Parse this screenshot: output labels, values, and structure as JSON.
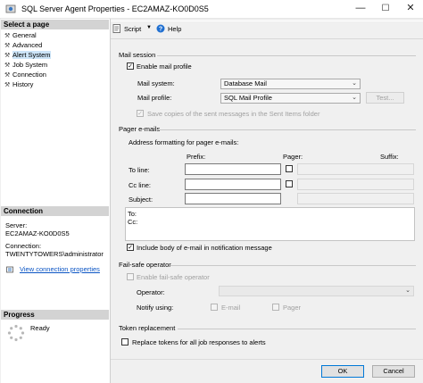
{
  "window": {
    "title": "SQL Server Agent Properties - EC2AMAZ-KO0D0S5",
    "minimize": "—",
    "maximize": "☐",
    "close": "✕"
  },
  "left": {
    "select_page_header": "Select a page",
    "pages": [
      {
        "label": "General"
      },
      {
        "label": "Advanced"
      },
      {
        "label": "Alert System"
      },
      {
        "label": "Job System"
      },
      {
        "label": "Connection"
      },
      {
        "label": "History"
      }
    ],
    "connection_header": "Connection",
    "server_label": "Server:",
    "server_value": "EC2AMAZ-KO0D0S5",
    "connection_label": "Connection:",
    "connection_value": "TWENTYTOWERS\\administrator",
    "view_link": "View connection properties",
    "progress_header": "Progress",
    "progress_status": "Ready"
  },
  "toolbar": {
    "script_label": "Script",
    "help_label": "Help"
  },
  "mail": {
    "section": "Mail session",
    "enable_label": "Enable mail profile",
    "enable_checked": true,
    "system_label": "Mail system:",
    "system_value": "Database Mail",
    "profile_label": "Mail profile:",
    "profile_value": "SQL Mail Profile",
    "test_label": "Test...",
    "save_copies_label": "Save copies of the sent messages in the Sent Items folder"
  },
  "pager": {
    "section": "Pager e-mails",
    "address_formatting": "Address formatting for pager e-mails:",
    "prefix_header": "Prefix:",
    "pager_header": "Pager:",
    "suffix_header": "Suffix:",
    "to_label": "To line:",
    "cc_label": "Cc line:",
    "subject_label": "Subject:",
    "preview_to": "To:",
    "preview_cc": "Cc:",
    "include_body_label": "Include body of e-mail in notification message",
    "include_body_checked": true
  },
  "failsafe": {
    "section": "Fail-safe operator",
    "enable_label": "Enable fail-safe operator",
    "operator_label": "Operator:",
    "notify_label": "Notify using:",
    "email_label": "E-mail",
    "pager_label": "Pager"
  },
  "token": {
    "section": "Token replacement",
    "replace_label": "Replace tokens for all job responses to alerts"
  },
  "footer": {
    "ok_label": "OK",
    "cancel_label": "Cancel"
  }
}
